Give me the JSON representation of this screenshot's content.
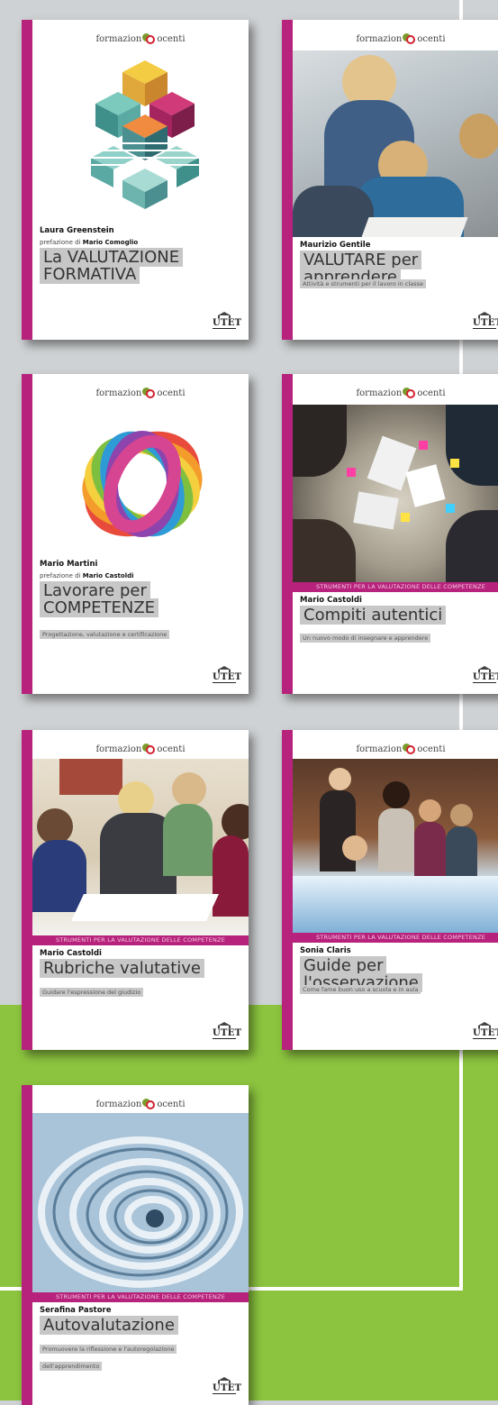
{
  "brand": {
    "series_prefix": "formazion",
    "series_suffix": "ocenti",
    "logo_icon": "ed-logo-icon",
    "publisher": "UTET",
    "accent_color": "#b7237c",
    "green_color": "#8cc43f"
  },
  "books": [
    {
      "author": "Laura Greenstein",
      "preface_label": "prefazione di",
      "preface_author": "Mario Comoglio",
      "title": "La VALUTAZIONE FORMATIVA",
      "subtitle": "",
      "band": "",
      "cover_image": "isometric-cubes-illustration"
    },
    {
      "author": "Maurizio Gentile",
      "title": "VALUTARE per apprendere",
      "subtitle": "Attività e strumenti per il lavoro in classe",
      "band": "",
      "cover_image": "teacher-and-students-photo"
    },
    {
      "author": "Mario Martini",
      "preface_label": "prefazione di",
      "preface_author": "Mario Castoldi",
      "title": "Lavorare per COMPETENZE",
      "subtitle": "Progettazione, valutazione e certificazione",
      "band": "",
      "cover_image": "rainbow-ribbon-sphere-illustration"
    },
    {
      "author": "Mario Castoldi",
      "title": "Compiti autentici",
      "subtitle": "Un nuovo modo di insegnare e apprendere",
      "band": "STRUMENTI PER LA VALUTAZIONE DELLE COMPETENZE",
      "cover_image": "group-worktable-photo"
    },
    {
      "author": "Mario Castoldi",
      "title": "Rubriche valutative",
      "subtitle": "Guidare l'espressione del giudizio",
      "band": "STRUMENTI PER LA VALUTAZIONE DELLE COMPETENZE",
      "cover_image": "women-meeting-photo"
    },
    {
      "author": "Sonia Claris",
      "title": "Guide per l'osservazione",
      "subtitle": "Come fame buon uso a scuola e in aula",
      "band": "STRUMENTI PER LA VALUTAZIONE DELLE COMPETENZE",
      "cover_image": "children-touch-table-photo"
    },
    {
      "author": "Serafina Pastore",
      "title": "Autovalutazione",
      "subtitle": "Promuovere la riflessione e l'autoregolazione dell'apprendimento",
      "band": "STRUMENTI PER LA VALUTAZIONE DELLE COMPETENZE",
      "cover_image": "spiral-staircase-photo"
    }
  ]
}
